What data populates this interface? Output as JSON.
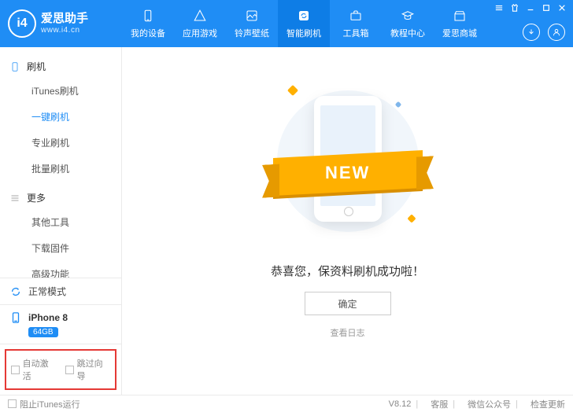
{
  "brand": {
    "logo_text": "i4",
    "name": "爱思助手",
    "url": "www.i4.cn"
  },
  "tabs": [
    {
      "id": "devices",
      "label": "我的设备"
    },
    {
      "id": "apps",
      "label": "应用游戏"
    },
    {
      "id": "ringtone",
      "label": "铃声壁纸"
    },
    {
      "id": "flash",
      "label": "智能刷机"
    },
    {
      "id": "toolbox",
      "label": "工具箱"
    },
    {
      "id": "tutorial",
      "label": "教程中心"
    },
    {
      "id": "store",
      "label": "爱思商城"
    }
  ],
  "active_tab": "flash",
  "sidebar": {
    "groups": [
      {
        "id": "flash",
        "label": "刷机",
        "items": [
          {
            "id": "itunes-flash",
            "label": "iTunes刷机"
          },
          {
            "id": "oneclick",
            "label": "一键刷机"
          },
          {
            "id": "pro-flash",
            "label": "专业刷机"
          },
          {
            "id": "batch-flash",
            "label": "批量刷机"
          }
        ]
      },
      {
        "id": "more",
        "label": "更多",
        "items": [
          {
            "id": "other-tools",
            "label": "其他工具"
          },
          {
            "id": "dl-fw",
            "label": "下载固件"
          },
          {
            "id": "advanced",
            "label": "高级功能"
          }
        ]
      }
    ],
    "active_item": "oneclick",
    "mode": "正常模式",
    "device": {
      "name": "iPhone 8",
      "capacity": "64GB"
    },
    "checks": {
      "auto_activate": "自动激活",
      "skip_guide": "跳过向导"
    }
  },
  "main": {
    "ribbon": "NEW",
    "success": "恭喜您，保资料刷机成功啦！",
    "ok": "确定",
    "view_log": "查看日志"
  },
  "footer": {
    "block_itunes": "阻止iTunes运行",
    "version": "V8.12",
    "support": "客服",
    "wechat": "微信公众号",
    "update": "检查更新"
  }
}
